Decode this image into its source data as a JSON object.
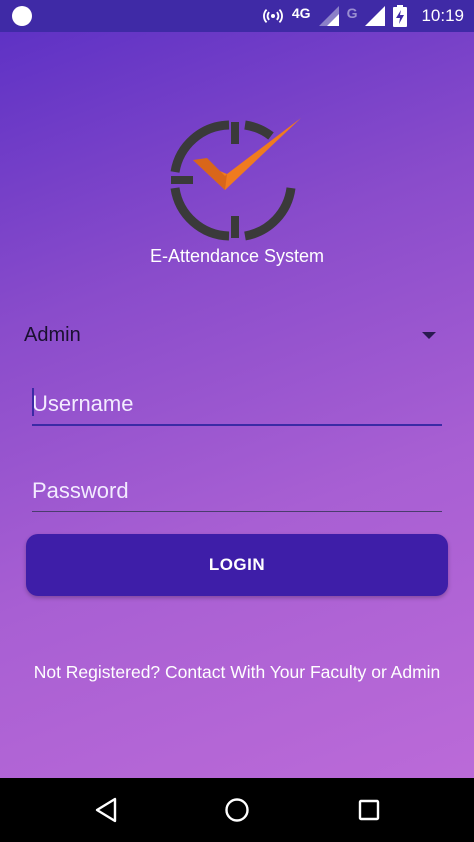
{
  "status_bar": {
    "network_primary": "4G",
    "network_secondary": "G",
    "time": "10:19"
  },
  "app": {
    "title": "E-Attendance System",
    "logo_icon": "clock-check-logo",
    "colors": {
      "clock": "#3a3a3a",
      "check": "#f07b1e",
      "button": "#3e1ea8"
    }
  },
  "form": {
    "role_selected": "Admin",
    "username_placeholder": "Username",
    "password_placeholder": "Password",
    "login_label": "LOGIN"
  },
  "footer": {
    "register_text": "Not Registered? Contact With Your Faculty or Admin"
  },
  "nav_bar": {
    "back_icon": "back-triangle-icon",
    "home_icon": "home-circle-icon",
    "recents_icon": "recents-square-icon"
  }
}
